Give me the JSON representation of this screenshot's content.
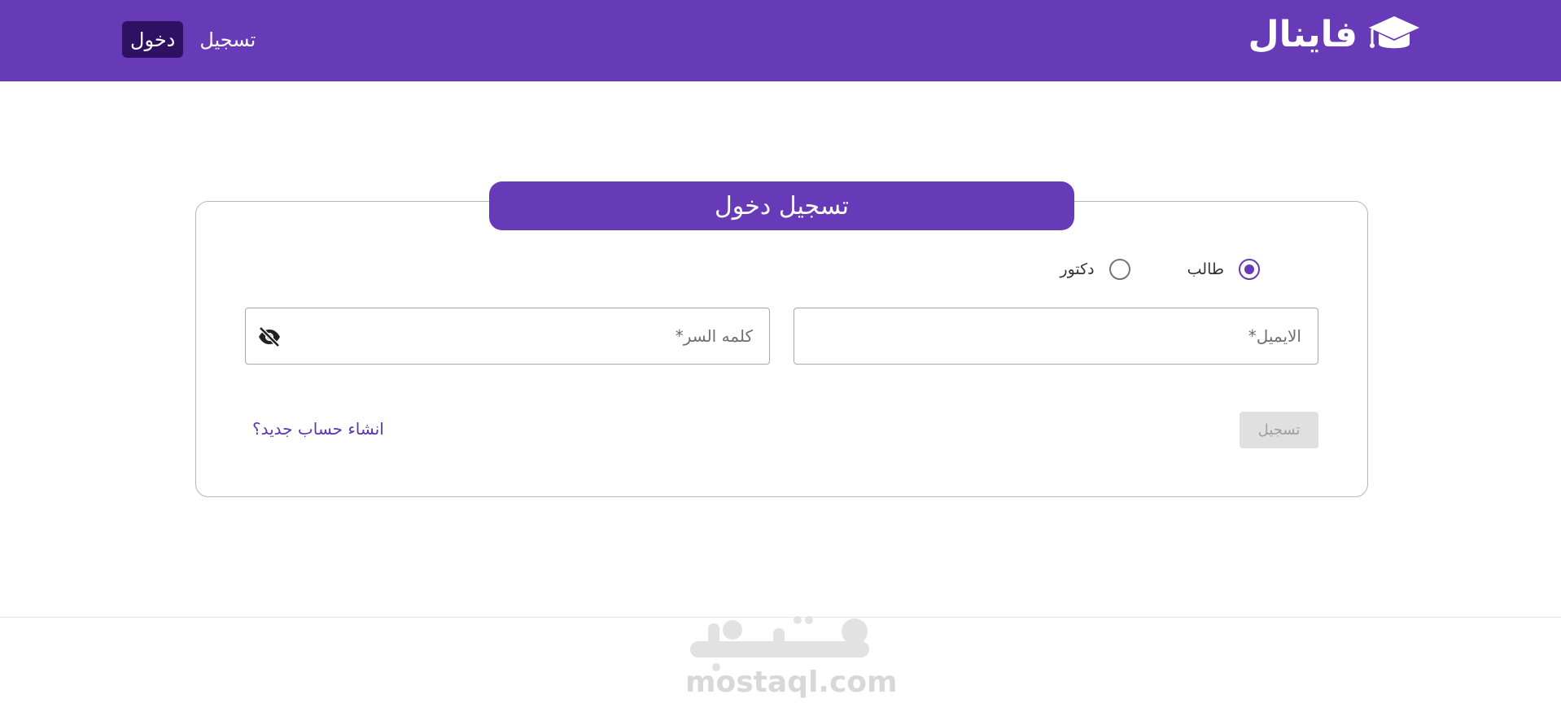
{
  "header": {
    "brand_name": "فاينال",
    "nav_login": "دخول",
    "nav_register": "تسجيل",
    "bg_color": "#673ab7"
  },
  "login_card": {
    "title": "تسجيل دخول",
    "roles": [
      {
        "label": "طالب",
        "selected": true
      },
      {
        "label": "دكتور",
        "selected": false
      }
    ],
    "email": {
      "placeholder": "الايميل*",
      "value": ""
    },
    "password": {
      "placeholder": "كلمه السر*",
      "value": ""
    },
    "submit_label": "تسجيل",
    "signup_link": "انشاء حساب جديد؟"
  },
  "watermark": {
    "logo_text": "مستقل",
    "domain": "mostaql.com"
  }
}
